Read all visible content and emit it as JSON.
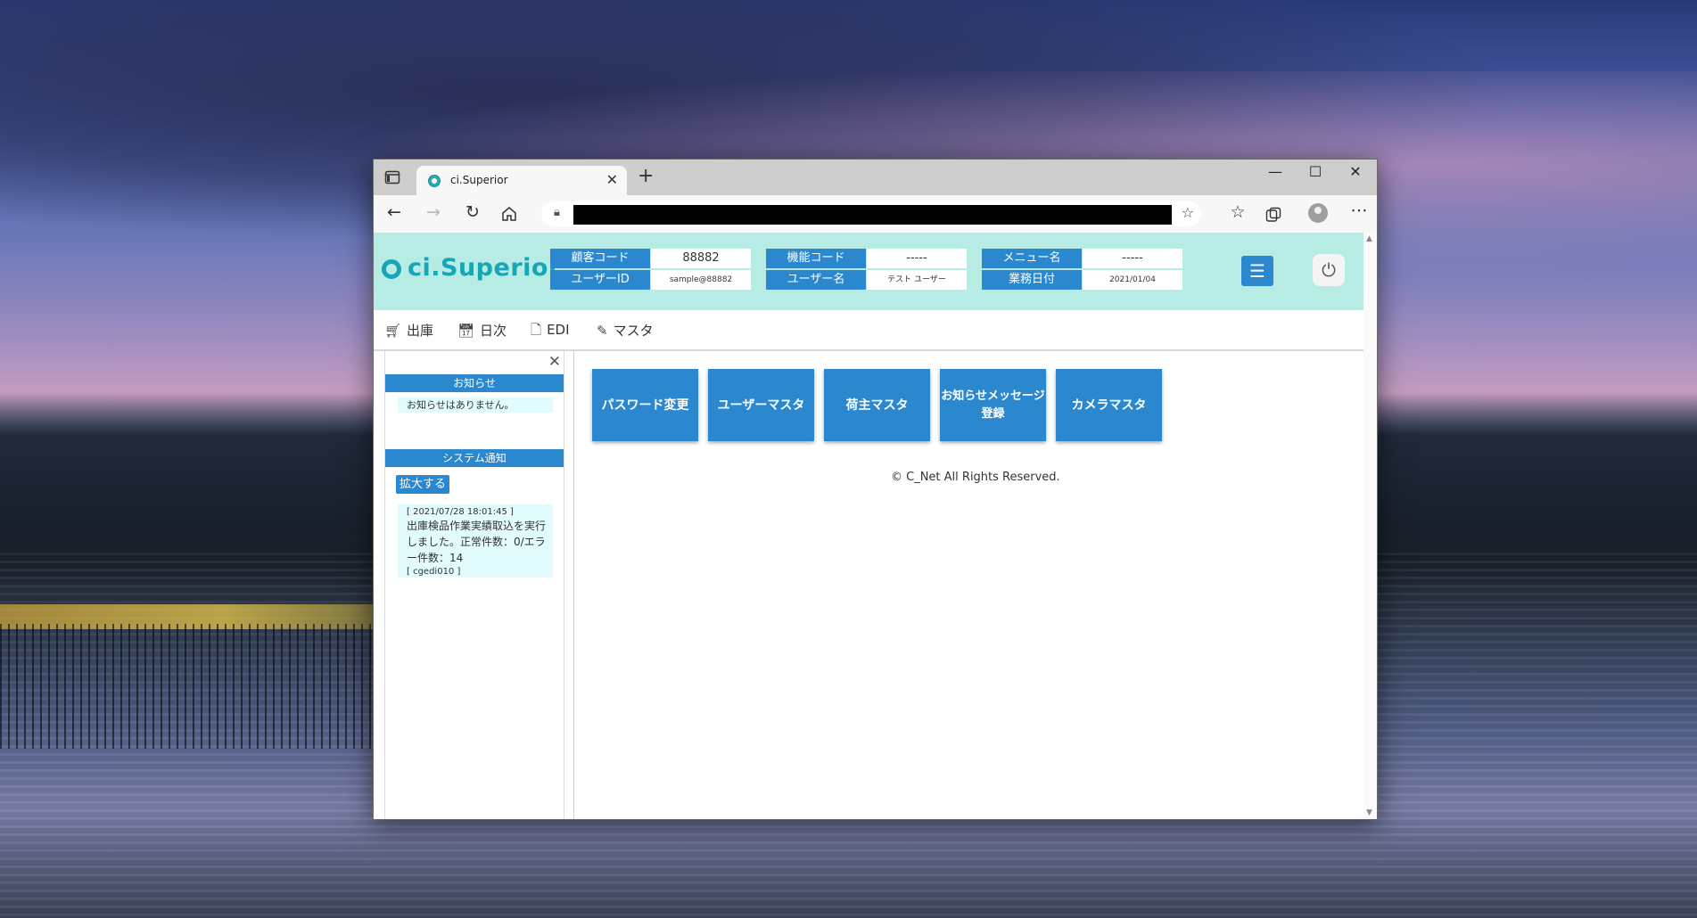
{
  "browser": {
    "tab_title": "ci.Superior",
    "tab_close": "✕",
    "new_tab": "+",
    "minimize": "—",
    "maximize": "☐",
    "close": "✕"
  },
  "header": {
    "logo": "ci.Superior",
    "fields": [
      {
        "label": "顧客コード",
        "value": "88882"
      },
      {
        "label": "ユーザーID",
        "value": "sample@88882"
      },
      {
        "label": "機能コード",
        "value": "-----"
      },
      {
        "label": "ユーザー名",
        "value": "テスト ユーザー"
      },
      {
        "label": "メニュー名",
        "value": "-----"
      },
      {
        "label": "業務日付",
        "value": "2021/01/04"
      }
    ]
  },
  "nav": [
    {
      "label": "出庫",
      "icon": "cart-icon"
    },
    {
      "label": "日次",
      "icon": "calendar-icon"
    },
    {
      "label": "EDI",
      "icon": "document-icon"
    },
    {
      "label": "マスタ",
      "icon": "pencil-icon"
    }
  ],
  "sidebar": {
    "notice_title": "お知らせ",
    "notice_text": "お知らせはありません。",
    "system_title": "システム通知",
    "expand_label": "拡大する",
    "system_item": {
      "timestamp": "[ 2021/07/28 18:01:45 ]",
      "message": "出庫検品作業実績取込を実行しました。正常件数：0/エラー件数：14",
      "code": "[ cgedi010 ]"
    }
  },
  "main": {
    "tiles": [
      "パスワード変更",
      "ユーザーマスタ",
      "荷主マスタ",
      "お知らせメッセージ登録",
      "カメラマスタ"
    ],
    "copyright": "© C_Net All Rights Reserved."
  },
  "colors": {
    "accent": "#2b88cf",
    "header_bg": "#b6ece3",
    "logo": "#16a6b5",
    "notice_bg": "#e2fbfd"
  }
}
